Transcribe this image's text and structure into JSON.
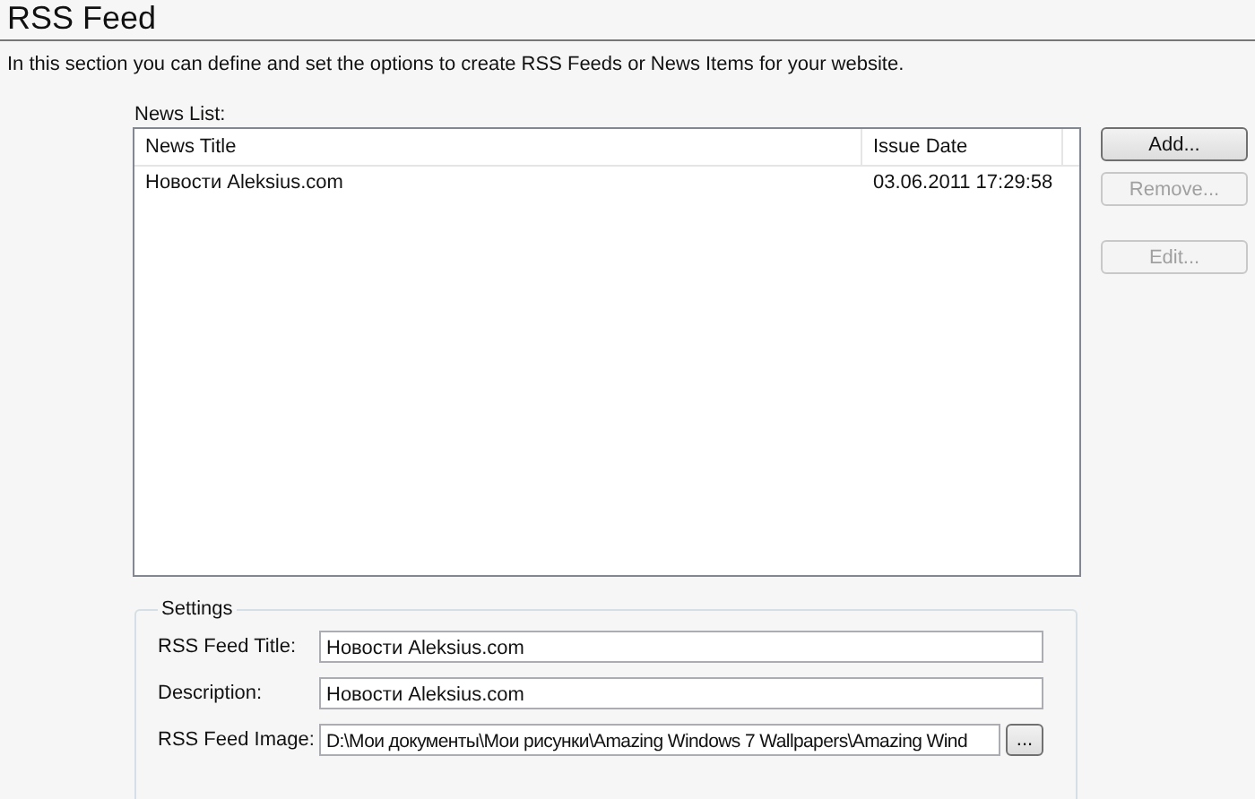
{
  "page": {
    "title": "RSS Feed",
    "description": "In this section you can define and set the options to create RSS Feeds or News Items for your website."
  },
  "news_list": {
    "label": "News List:",
    "columns": [
      "News Title",
      "Issue Date"
    ],
    "rows": [
      {
        "cells": [
          "Новости Aleksius.com",
          "03.06.2011 17:29:58"
        ],
        "selected": false
      }
    ]
  },
  "buttons": [
    {
      "label": "Add...",
      "disabled": false
    },
    {
      "label": "Remove...",
      "disabled": true
    },
    {
      "label": "Edit...",
      "disabled": true
    }
  ],
  "settings": {
    "legend": "Settings",
    "fields": [
      {
        "label": "RSS Feed Title:",
        "value": "Новости Aleksius.com",
        "kind": "text"
      },
      {
        "label": "Description:",
        "value": "Новости Aleksius.com",
        "kind": "text"
      },
      {
        "label": "RSS Feed Image:",
        "value": "D:\\Мои документы\\Мои рисунки\\Amazing Windows 7 Wallpapers\\Amazing Wind",
        "kind": "file",
        "browse": "..."
      }
    ]
  }
}
